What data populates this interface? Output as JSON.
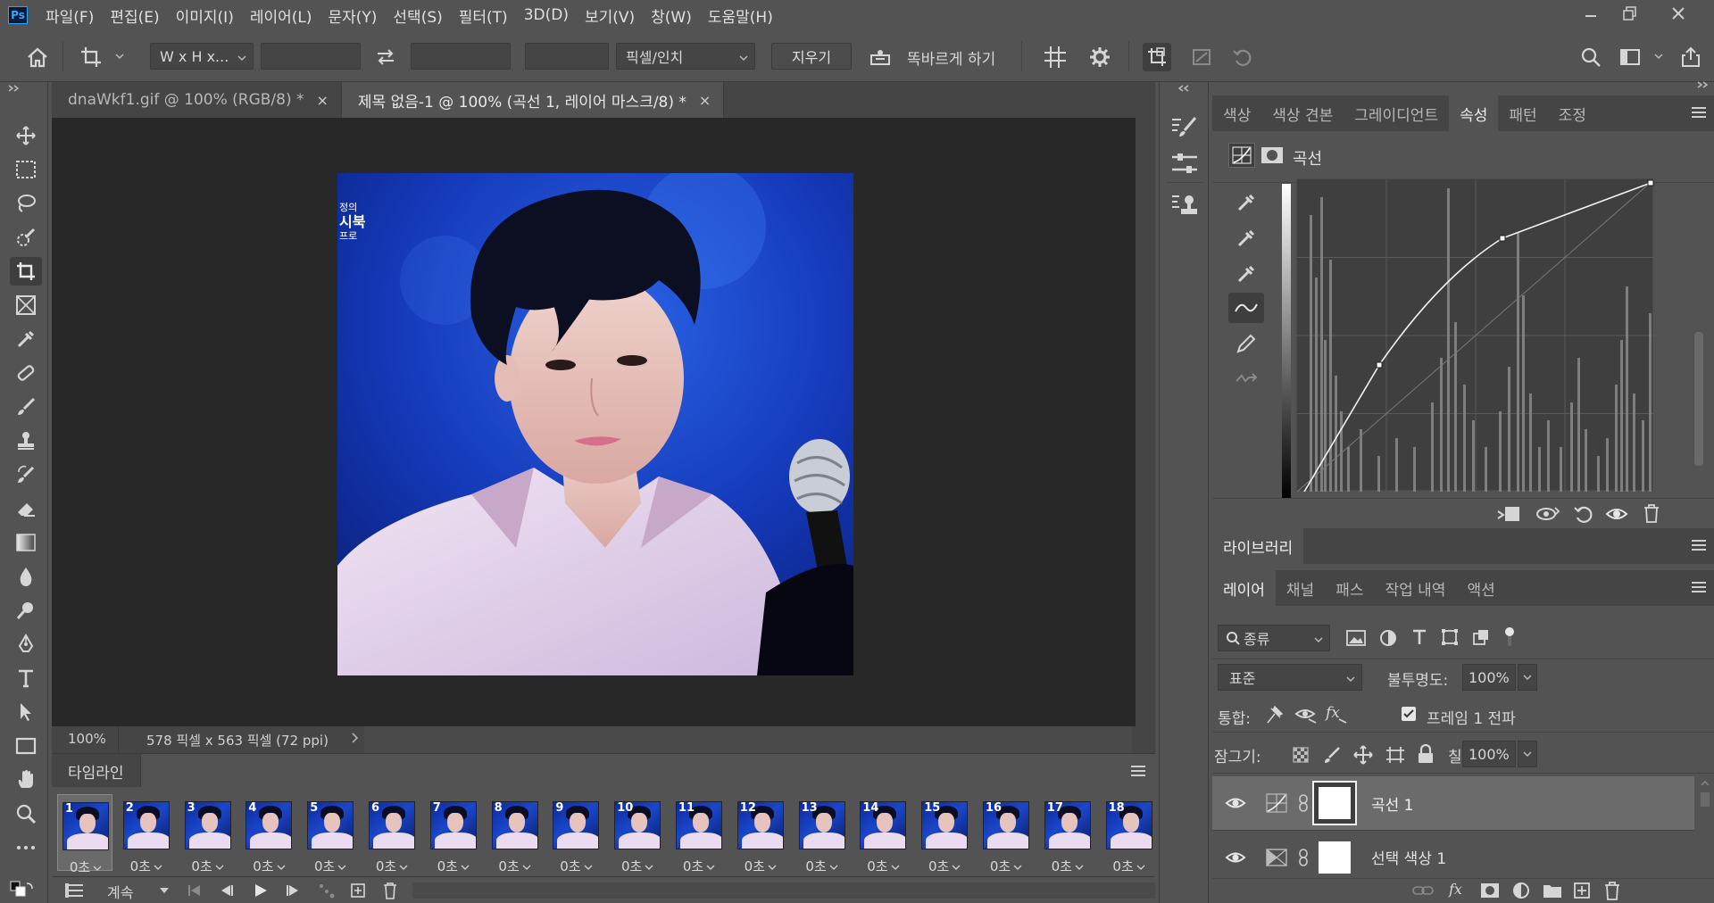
{
  "app": {
    "logo": "Ps",
    "menu": [
      "파일(F)",
      "편집(E)",
      "이미지(I)",
      "레이어(L)",
      "문자(Y)",
      "선택(S)",
      "필터(T)",
      "3D(D)",
      "보기(V)",
      "창(W)",
      "도움말(H)"
    ]
  },
  "options_bar": {
    "ratio_label": "W x H x...",
    "units_label": "픽셀/인치",
    "clear_label": "지우기",
    "straighten_label": "똑바르게 하기"
  },
  "documents": {
    "tabs": [
      {
        "label": "dnaWkf1.gif @ 100% (RGB/8) *"
      },
      {
        "label": "제목 없음-1 @ 100% (곡선 1, 레이어 마스크/8) *"
      }
    ],
    "close_glyph": "×",
    "zoom": "100%",
    "doc_info": "578 픽셀 x 563 픽셀 (72 ppi)",
    "canvas_overlay_text": [
      "정의",
      "시북",
      "프로"
    ]
  },
  "timeline": {
    "title": "타임라인",
    "loop_label": "계속",
    "frames": [
      {
        "n": "1",
        "dur": "0초"
      },
      {
        "n": "2",
        "dur": "0초"
      },
      {
        "n": "3",
        "dur": "0초"
      },
      {
        "n": "4",
        "dur": "0초"
      },
      {
        "n": "5",
        "dur": "0초"
      },
      {
        "n": "6",
        "dur": "0초"
      },
      {
        "n": "7",
        "dur": "0초"
      },
      {
        "n": "8",
        "dur": "0초"
      },
      {
        "n": "9",
        "dur": "0초"
      },
      {
        "n": "10",
        "dur": "0초"
      },
      {
        "n": "11",
        "dur": "0초"
      },
      {
        "n": "12",
        "dur": "0초"
      },
      {
        "n": "13",
        "dur": "0초"
      },
      {
        "n": "14",
        "dur": "0초"
      },
      {
        "n": "15",
        "dur": "0초"
      },
      {
        "n": "16",
        "dur": "0초"
      },
      {
        "n": "17",
        "dur": "0초"
      },
      {
        "n": "18",
        "dur": "0초"
      }
    ],
    "selected_frame": 1
  },
  "properties_panel": {
    "tabs": [
      "색상",
      "색상 견본",
      "그레이디언트",
      "속성",
      "패턴",
      "조정"
    ],
    "active_tab": "속성",
    "adjustment_title": "곡선"
  },
  "library_panel": {
    "title": "라이브러리"
  },
  "layers_panel": {
    "tabs": [
      "레이어",
      "채널",
      "패스",
      "작업 내역",
      "액션"
    ],
    "active_tab": "레이어",
    "filter_label": "종류",
    "blend_mode": "표준",
    "opacity_label": "불투명도:",
    "opacity_value": "100%",
    "unify_label": "통합:",
    "propagate_label": "프레임 1 전파",
    "lock_label": "잠그기:",
    "fill_label": "칠:",
    "fill_value": "100%",
    "layers": [
      {
        "name": "곡선 1",
        "selected": true
      },
      {
        "name": "선택 색상 1",
        "selected": false
      }
    ]
  }
}
